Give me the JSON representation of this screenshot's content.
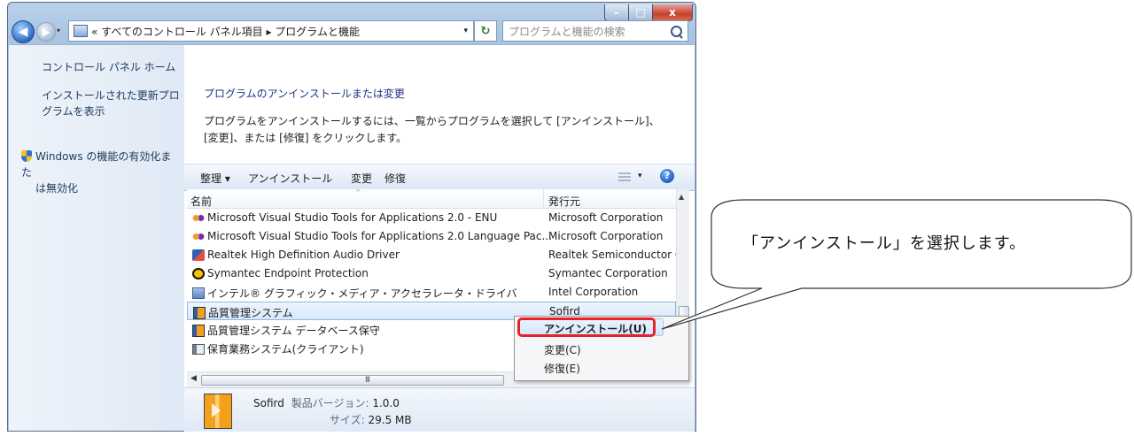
{
  "window": {
    "caption_buttons": [
      "–",
      "□",
      "x"
    ]
  },
  "nav": {
    "back_glyph": "◀",
    "forward_glyph": "▶",
    "address": "« すべてのコントロール パネル項目 ▸ プログラムと機能",
    "address_dropdown": "▾",
    "refresh_glyph": "↻",
    "search_placeholder": "プログラムと機能の検索"
  },
  "sidebar": {
    "home": "コントロール パネル ホーム",
    "updates": "インストールされた更新プログラムを表示",
    "features_line1": "Windows の機能の有効化また",
    "features_line2": "は無効化"
  },
  "main": {
    "title": "プログラムのアンインストールまたは変更",
    "description": "プログラムをアンインストールするには、一覧からプログラムを選択して [アンインストール]、[変更]、または [修復] をクリックします。"
  },
  "toolbar": {
    "organize": "整理 ▾",
    "uninstall": "アンインストール",
    "change": "変更",
    "repair": "修復",
    "view_dropdown": "▾",
    "help": "?"
  },
  "list": {
    "headers": {
      "name": "名前",
      "publisher": "発行元",
      "sort": "^"
    },
    "rows": [
      {
        "name": "Microsoft Visual Studio Tools for Applications 2.0 - ENU",
        "publisher": "Microsoft Corporation",
        "icon": "vs-icon"
      },
      {
        "name": "Microsoft Visual Studio Tools for Applications 2.0 Language Pac...",
        "publisher": "Microsoft Corporation",
        "icon": "vs-icon"
      },
      {
        "name": "Realtek High Definition Audio Driver",
        "publisher": "Realtek Semiconductor C",
        "icon": "realtek-icon"
      },
      {
        "name": "Symantec Endpoint Protection",
        "publisher": "Symantec Corporation",
        "icon": "symantec-icon"
      },
      {
        "name": "インテル® グラフィック・メディア・アクセラレータ・ドライバ",
        "publisher": "Intel Corporation",
        "icon": "intel-icon"
      },
      {
        "name": "品質管理システム",
        "publisher": "Sofird",
        "icon": "app-icon"
      },
      {
        "name": "品質管理システム データベース保守",
        "publisher": "",
        "icon": "app-icon"
      },
      {
        "name": "保育業務システム(クライアント)",
        "publisher": "",
        "icon": "window-icon"
      }
    ],
    "scroll": {
      "up": "▲",
      "left": "◀",
      "right": "▶",
      "grip": "III"
    }
  },
  "details": {
    "publisher": "Sofird",
    "version_label": "製品バージョン:",
    "version": "1.0.0",
    "size_label": "サイズ:",
    "size": "29.5 MB"
  },
  "context_menu": {
    "uninstall": "アンインストール(U)",
    "change": "変更(C)",
    "repair": "修復(E)"
  },
  "callout": {
    "text": "「アンインストール」を選択します。"
  },
  "colors": {
    "highlight_box": "#e8202a",
    "link": "#1e3287",
    "window_frame": "#a9c3e2"
  }
}
